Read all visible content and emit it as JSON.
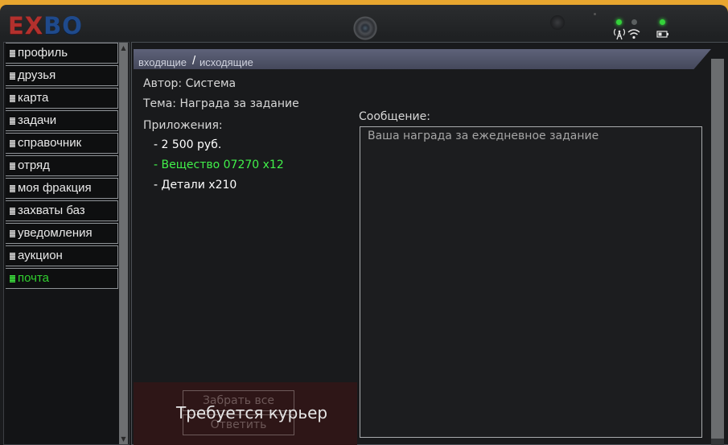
{
  "device": {
    "logo_part1": "EX",
    "logo_part2": "BO",
    "status_icons": {
      "signal": "antenna-icon",
      "wifi": "wifi-icon",
      "battery": "battery-icon"
    }
  },
  "sidebar": {
    "items": [
      {
        "label": "профиль",
        "active": false
      },
      {
        "label": "друзья",
        "active": false
      },
      {
        "label": "карта",
        "active": false
      },
      {
        "label": "задачи",
        "active": false
      },
      {
        "label": "справочник",
        "active": false
      },
      {
        "label": "отряд",
        "active": false
      },
      {
        "label": "моя фракция",
        "active": false
      },
      {
        "label": "захваты баз",
        "active": false
      },
      {
        "label": "уведомления",
        "active": false
      },
      {
        "label": "аукцион",
        "active": false
      },
      {
        "label": "почта",
        "active": true
      }
    ]
  },
  "mail": {
    "tabs": {
      "inbox": "входящие",
      "separator": "/",
      "outbox": "исходящие"
    },
    "author": "Автор: Система",
    "subject": "Тема: Награда за задание",
    "attachments_label": "Приложения:",
    "attachments": [
      {
        "text": "- 2 500 руб.",
        "highlight": false
      },
      {
        "text": "- Вещество 07270 x12",
        "highlight": true
      },
      {
        "text": "- Детали x210",
        "highlight": false
      }
    ],
    "message_label": "Сообщение:",
    "message_body": "Ваша награда за ежедневное задание",
    "take_all_label": "Забрать все",
    "reply_label": "Ответить",
    "courier_notice": "Требуется курьер"
  },
  "colors": {
    "accent_green": "#41f14a",
    "frame_orange": "#e8a62f",
    "logo_red": "#b3302d",
    "logo_blue": "#1f4a8c"
  }
}
